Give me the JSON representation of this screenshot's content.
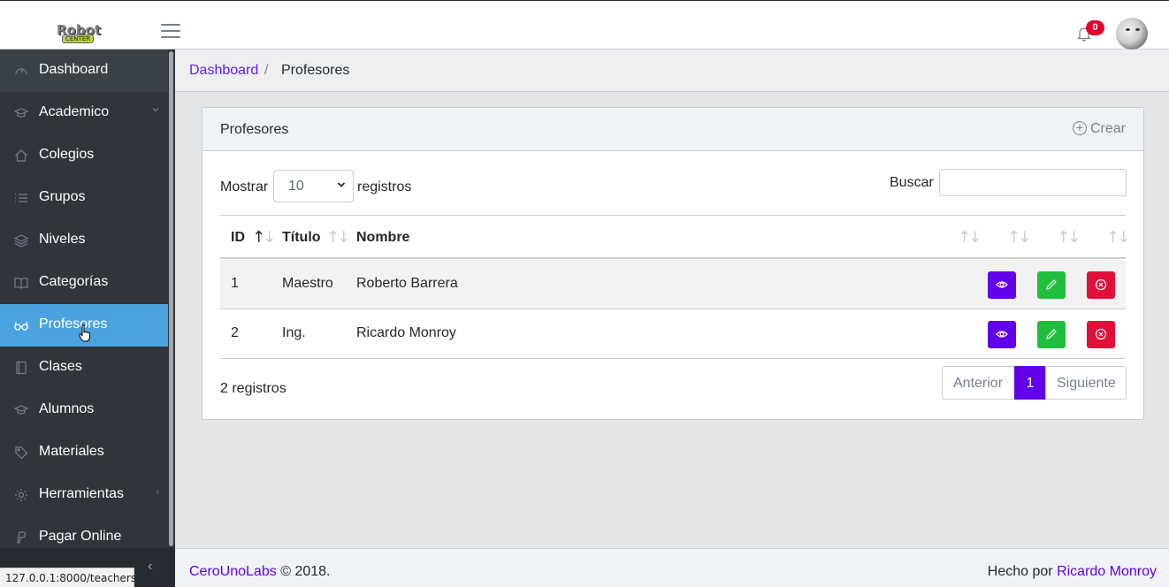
{
  "brand": {
    "logo_top": "Robot",
    "logo_bottom": "CENTER"
  },
  "header": {
    "notifications_count": "0"
  },
  "sidebar": {
    "items": [
      {
        "label": "Dashboard",
        "icon": "speedometer-icon"
      },
      {
        "label": "Academico",
        "icon": "graduation-cap-icon",
        "chevron": "‹"
      },
      {
        "label": "Colegios",
        "icon": "home-icon"
      },
      {
        "label": "Grupos",
        "icon": "list-icon"
      },
      {
        "label": "Niveles",
        "icon": "layers-icon"
      },
      {
        "label": "Categorías",
        "icon": "book-open-icon"
      },
      {
        "label": "Profesores",
        "icon": "eyeglasses-icon"
      },
      {
        "label": "Clases",
        "icon": "notebook-icon"
      },
      {
        "label": "Alumnos",
        "icon": "graduation-cap-icon"
      },
      {
        "label": "Materiales",
        "icon": "tag-icon"
      },
      {
        "label": "Herramientas",
        "icon": "gear-icon",
        "chevron": "‹"
      },
      {
        "label": "Pagar Online",
        "icon": "paypal-icon"
      }
    ],
    "minimizer": "‹",
    "status_url": "127.0.0.1:8000/teachers"
  },
  "breadcrumb": {
    "home": "Dashboard",
    "separator": "/",
    "current": "Profesores"
  },
  "card": {
    "title": "Profesores",
    "create_label": "Crear",
    "show_label": "Mostrar",
    "page_size": "10",
    "records_label": "registros",
    "search_label": "Buscar",
    "search_value": ""
  },
  "table": {
    "columns": [
      "ID",
      "Título",
      "Nombre",
      "",
      "",
      "",
      ""
    ],
    "rows": [
      {
        "id": "1",
        "titulo": "Maestro",
        "nombre": "Roberto Barrera"
      },
      {
        "id": "2",
        "titulo": "Ing.",
        "nombre": "Ricardo Monroy"
      }
    ]
  },
  "pagination": {
    "summary": "2 registros",
    "prev": "Anterior",
    "current": "1",
    "next": "Siguiente"
  },
  "footer": {
    "company": "CeroUnoLabs",
    "copyright": "© 2018.",
    "made_by": "Hecho por",
    "author": "Ricardo Monroy"
  },
  "colors": {
    "primary": "#6200ea",
    "success": "#1fbf3b",
    "danger": "#e0103b",
    "sidebar_bg": "#2f353a",
    "sidebar_active": "#4aa3df"
  }
}
